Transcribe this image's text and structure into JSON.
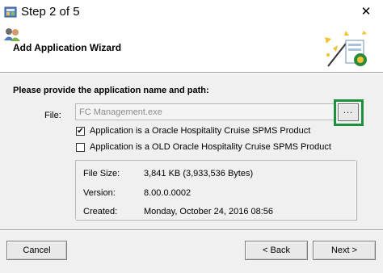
{
  "window": {
    "title": "Step 2 of 5",
    "close_glyph": "✕",
    "app_icon": "app-setup-icon"
  },
  "header": {
    "title": "Add Application Wizard",
    "left_icon": "users-icon",
    "right_icon": "wizard-magic-icon"
  },
  "main": {
    "instruction": "Please provide the application name and path:",
    "file_label": "File:",
    "file_value": "FC Management.exe",
    "browse_label": "...",
    "options": [
      {
        "label": "Application is a Oracle Hospitality Cruise SPMS Product",
        "checked": true,
        "mark": "✔"
      },
      {
        "label": "Application is a OLD Oracle Hospitality Cruise SPMS Product",
        "checked": false,
        "mark": ""
      }
    ],
    "info": {
      "file_size_label": "File Size:",
      "file_size_value": "3,841 KB (3,933,536 Bytes)",
      "version_label": "Version:",
      "version_value": "8.00.0.0002",
      "created_label": "Created:",
      "created_value": "Monday, October 24, 2016 08:56"
    }
  },
  "footer": {
    "cancel_label": "Cancel",
    "back_label": "< Back",
    "next_label": "Next >"
  },
  "colors": {
    "highlight": "#1e8f3c"
  }
}
